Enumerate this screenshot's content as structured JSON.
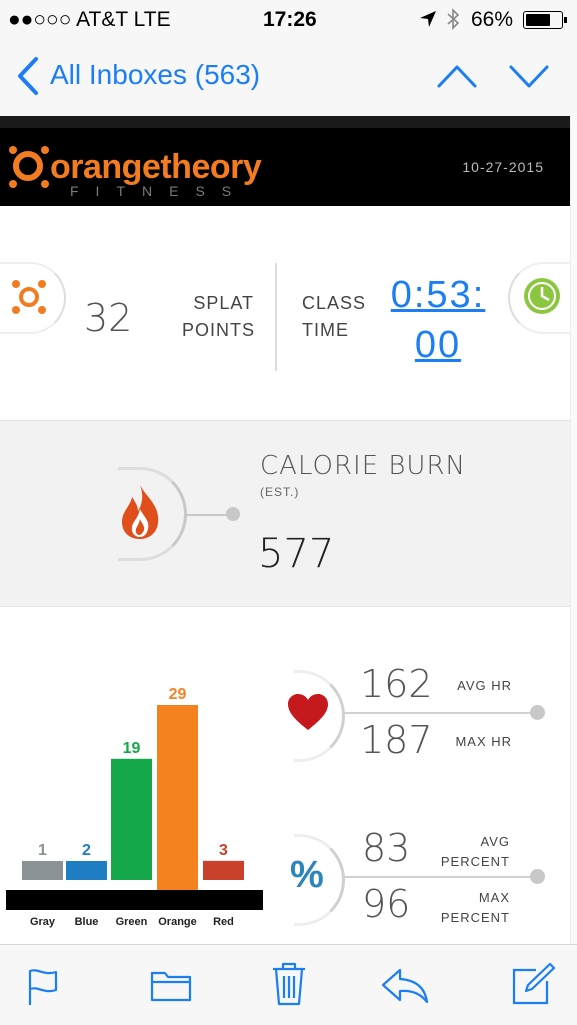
{
  "status_bar": {
    "carrier": "●●○○○ AT&T   LTE",
    "time": "17:26",
    "battery": "66%"
  },
  "nav": {
    "back_label": "All Inboxes (563)"
  },
  "email": {
    "logo_main": "orangetheory",
    "logo_sub": "FITNESS",
    "date": "10-27-2015",
    "splat_points_value": "32",
    "splat_points_label_1": "SPLAT",
    "splat_points_label_2": "POINTS",
    "class_time_label_1": "CLASS",
    "class_time_label_2": "TIME",
    "class_time_line_1": "0:53:",
    "class_time_line_2": "00",
    "calorie_title": "CALORIE BURN",
    "calorie_est": "(EST.)",
    "calorie_value": "577",
    "avg_hr_value": "162",
    "avg_hr_label": "AVG HR",
    "max_hr_value": "187",
    "max_hr_label": "MAX HR",
    "avg_percent_value": "83",
    "avg_percent_label_1": "AVG",
    "avg_percent_label_2": "PERCENT",
    "max_percent_value": "96",
    "max_percent_label_1": "MAX",
    "max_percent_label_2": "PERCENT",
    "percent_symbol": "%"
  },
  "chart_data": {
    "type": "bar",
    "categories": [
      "Gray",
      "Blue",
      "Green",
      "Orange",
      "Red"
    ],
    "values": [
      1,
      2,
      19,
      29,
      3
    ],
    "colors": [
      "#8a9296",
      "#1f7dc3",
      "#14a84b",
      "#f4831f",
      "#c9412b"
    ],
    "label_colors": [
      "#8a9296",
      "#1f7dc3",
      "#14a84b",
      "#f4831f",
      "#c9412b"
    ]
  },
  "toolbar": {
    "icons": [
      "flag-icon",
      "folder-icon",
      "trash-icon",
      "reply-icon",
      "compose-icon"
    ]
  },
  "colors": {
    "ios_blue": "#1b7ef5",
    "brand_orange": "#f47c20"
  }
}
